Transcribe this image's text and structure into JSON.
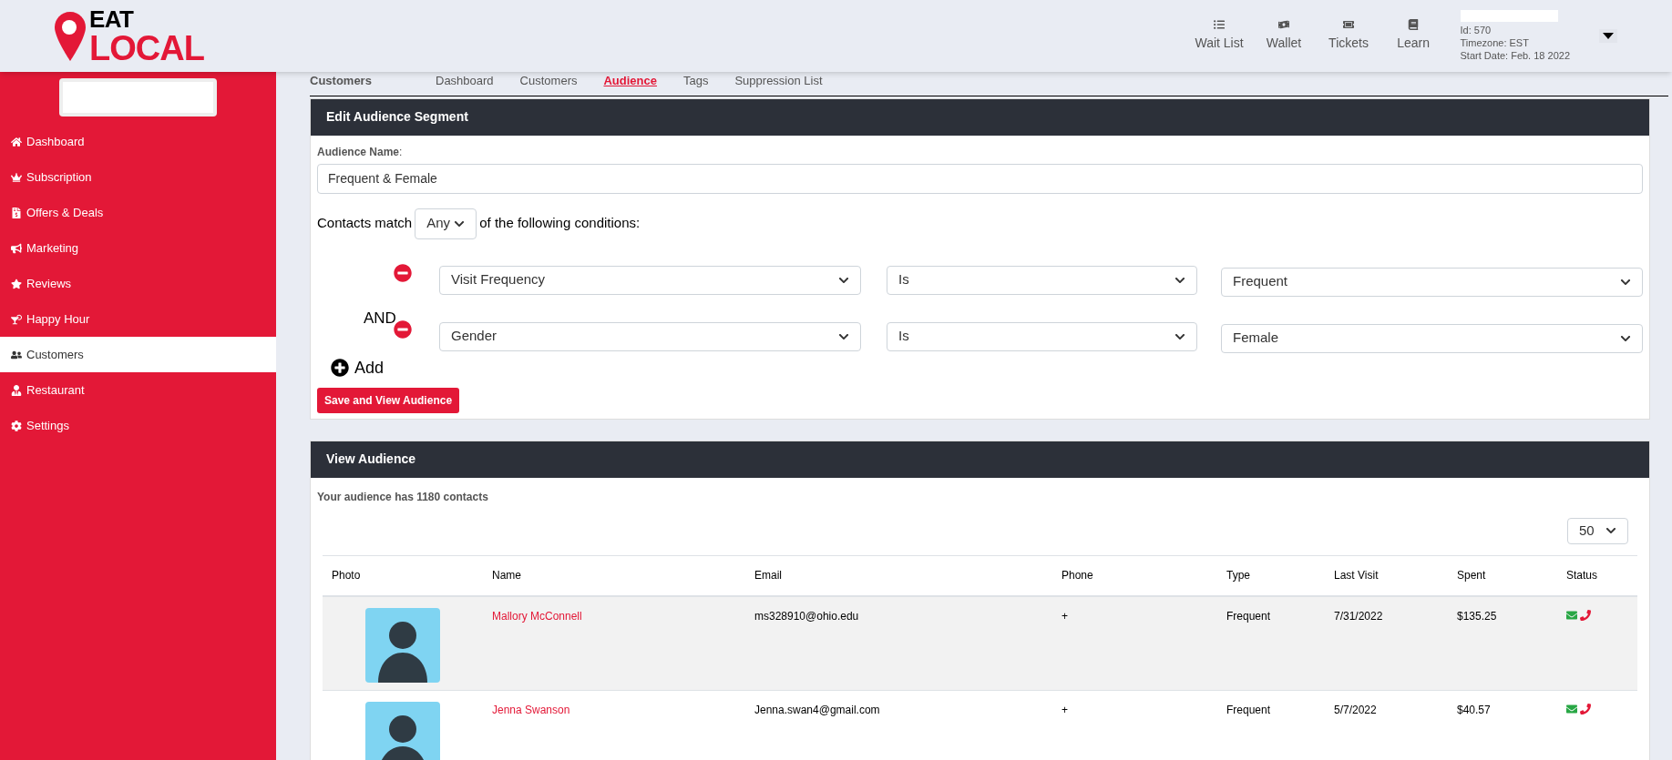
{
  "logo": {
    "top": "EAT",
    "bottom": "LOCAL"
  },
  "top_nav": [
    {
      "label": "Wait List"
    },
    {
      "label": "Wallet"
    },
    {
      "label": "Tickets"
    },
    {
      "label": "Learn"
    }
  ],
  "account": {
    "lines": [
      "Id: 570",
      "Timezone: EST",
      "Start Date: Feb. 18 2022"
    ]
  },
  "sidebar": {
    "items": [
      {
        "label": "Dashboard",
        "selected": false
      },
      {
        "label": "Subscription",
        "selected": false
      },
      {
        "label": "Offers & Deals",
        "selected": false
      },
      {
        "label": "Marketing",
        "selected": false
      },
      {
        "label": "Reviews",
        "selected": false
      },
      {
        "label": "Happy Hour",
        "selected": false
      },
      {
        "label": "Customers",
        "selected": true
      },
      {
        "label": "Restaurant",
        "selected": false
      },
      {
        "label": "Settings",
        "selected": false
      }
    ]
  },
  "section_title": "Customers",
  "tabs": [
    {
      "label": "Dashboard",
      "selected": false
    },
    {
      "label": "Customers",
      "selected": false
    },
    {
      "label": "Audience",
      "selected": true
    },
    {
      "label": "Tags",
      "selected": false
    },
    {
      "label": "Suppression List",
      "selected": false
    }
  ],
  "edit_card": {
    "title": "Edit Audience Segment",
    "name_label": "Audience Name",
    "name_colon": ":",
    "name_value": "Frequent & Female",
    "match_prefix": "Contacts match",
    "match_value": "Any",
    "match_suffix": "of the following conditions:",
    "conditions": [
      {
        "field": "Visit Frequency",
        "operator": "Is",
        "value": "Frequent"
      },
      {
        "field": "Gender",
        "operator": "Is",
        "value": "Female"
      }
    ],
    "joiner": "AND",
    "add_label": "Add",
    "save_button": "Save and View Audience"
  },
  "view_card": {
    "title": "View Audience",
    "summary": "Your audience has 1180 contacts",
    "page_size": "50",
    "table": {
      "columns": [
        "Photo",
        "Name",
        "Email",
        "Phone",
        "Type",
        "Last Visit",
        "Spent",
        "Status"
      ],
      "rows": [
        {
          "name": "Mallory McConnell",
          "email": "ms328910@ohio.edu",
          "phone": "+",
          "type": "Frequent",
          "last_visit": "7/31/2022",
          "spent": "$135.25",
          "shaded": true,
          "status": [
            {
              "kind": "email",
              "color": "#28a745"
            },
            {
              "kind": "phone",
              "color": "#e31837"
            }
          ]
        },
        {
          "name": "Jenna Swanson",
          "email": "Jenna.swan4@gmail.com",
          "phone": "+",
          "type": "Frequent",
          "last_visit": "5/7/2022",
          "spent": "$40.57",
          "shaded": false,
          "status": [
            {
              "kind": "email",
              "color": "#28a745"
            },
            {
              "kind": "phone",
              "color": "#e31837"
            }
          ]
        }
      ]
    }
  }
}
